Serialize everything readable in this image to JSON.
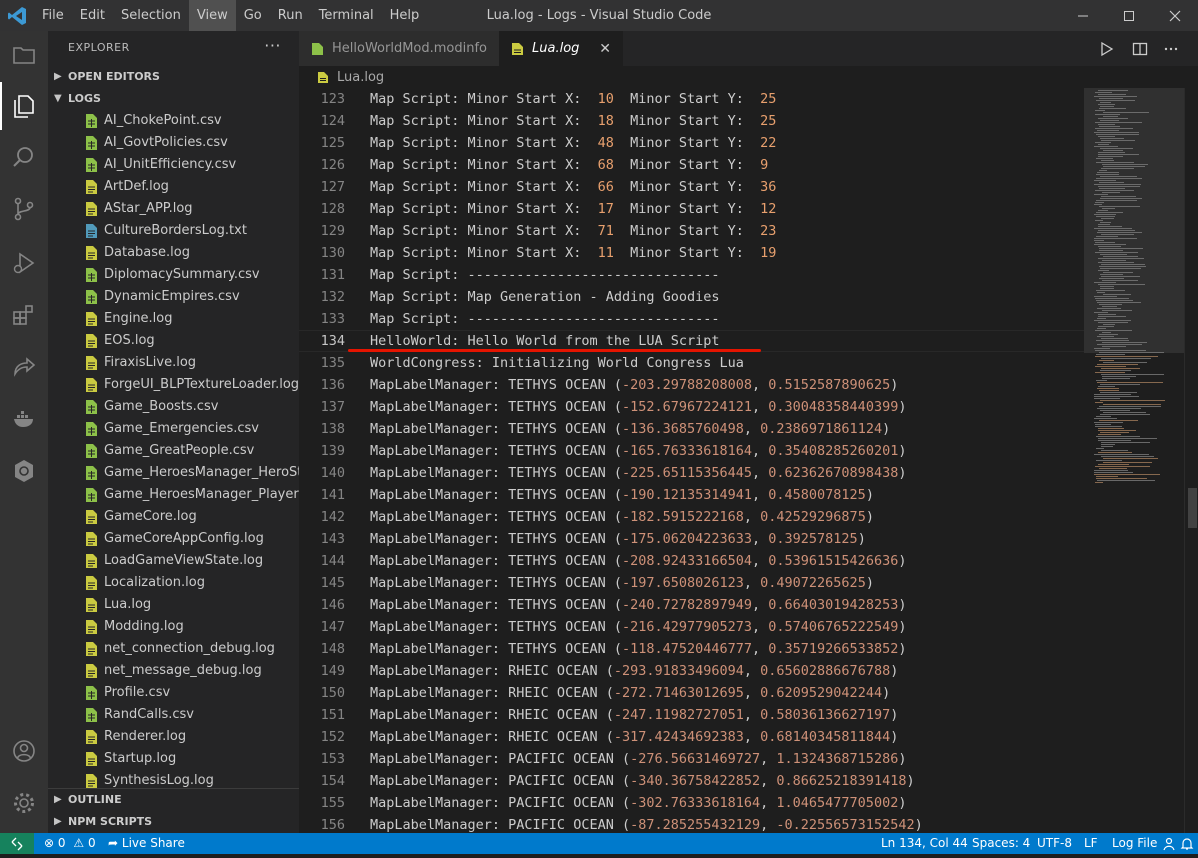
{
  "window": {
    "title": "Lua.log - Logs - Visual Studio Code"
  },
  "menu": [
    "File",
    "Edit",
    "Selection",
    "View",
    "Go",
    "Run",
    "Terminal",
    "Help"
  ],
  "explorer": {
    "title": "EXPLORER",
    "more": "···",
    "open_editors": "OPEN EDITORS",
    "folder": "LOGS",
    "files": [
      {
        "name": "AI_ChokePoint.csv",
        "type": "csv"
      },
      {
        "name": "AI_GovtPolicies.csv",
        "type": "csv"
      },
      {
        "name": "AI_UnitEfficiency.csv",
        "type": "csv"
      },
      {
        "name": "ArtDef.log",
        "type": "log"
      },
      {
        "name": "AStar_APP.log",
        "type": "log"
      },
      {
        "name": "CultureBordersLog.txt",
        "type": "txt"
      },
      {
        "name": "Database.log",
        "type": "log"
      },
      {
        "name": "DiplomacySummary.csv",
        "type": "csv"
      },
      {
        "name": "DynamicEmpires.csv",
        "type": "csv"
      },
      {
        "name": "Engine.log",
        "type": "log"
      },
      {
        "name": "EOS.log",
        "type": "log"
      },
      {
        "name": "FiraxisLive.log",
        "type": "log"
      },
      {
        "name": "ForgeUI_BLPTextureLoader.log",
        "type": "log"
      },
      {
        "name": "Game_Boosts.csv",
        "type": "csv"
      },
      {
        "name": "Game_Emergencies.csv",
        "type": "csv"
      },
      {
        "name": "Game_GreatPeople.csv",
        "type": "csv"
      },
      {
        "name": "Game_HeroesManager_HeroSta...",
        "type": "csv"
      },
      {
        "name": "Game_HeroesManager_PlayerSt...",
        "type": "csv"
      },
      {
        "name": "GameCore.log",
        "type": "log"
      },
      {
        "name": "GameCoreAppConfig.log",
        "type": "log"
      },
      {
        "name": "LoadGameViewState.log",
        "type": "log"
      },
      {
        "name": "Localization.log",
        "type": "log"
      },
      {
        "name": "Lua.log",
        "type": "log"
      },
      {
        "name": "Modding.log",
        "type": "log"
      },
      {
        "name": "net_connection_debug.log",
        "type": "log"
      },
      {
        "name": "net_message_debug.log",
        "type": "log"
      },
      {
        "name": "Profile.csv",
        "type": "csv"
      },
      {
        "name": "RandCalls.csv",
        "type": "csv"
      },
      {
        "name": "Renderer.log",
        "type": "log"
      },
      {
        "name": "Startup.log",
        "type": "log"
      },
      {
        "name": "SynthesisLog.log",
        "type": "log"
      }
    ],
    "outline": "OUTLINE",
    "npm_scripts": "NPM SCRIPTS"
  },
  "tabs": [
    {
      "label": "HelloWorldMod.modinfo",
      "active": false
    },
    {
      "label": "Lua.log",
      "active": true,
      "close": "✕"
    }
  ],
  "breadcrumb": "Lua.log",
  "editor": {
    "current_line": 134,
    "lines": [
      {
        "n": "123",
        "segs": [
          [
            "Map Script: Minor Start X:  ",
            ""
          ],
          [
            "10",
            "or"
          ],
          [
            "  Minor Start Y:  ",
            ""
          ],
          [
            "25",
            "or"
          ]
        ]
      },
      {
        "n": "124",
        "segs": [
          [
            "Map Script: Minor Start X:  ",
            ""
          ],
          [
            "18",
            "or"
          ],
          [
            "  Minor Start Y:  ",
            ""
          ],
          [
            "25",
            "or"
          ]
        ]
      },
      {
        "n": "125",
        "segs": [
          [
            "Map Script: Minor Start X:  ",
            ""
          ],
          [
            "48",
            "or"
          ],
          [
            "  Minor Start Y:  ",
            ""
          ],
          [
            "22",
            "or"
          ]
        ]
      },
      {
        "n": "126",
        "segs": [
          [
            "Map Script: Minor Start X:  ",
            ""
          ],
          [
            "68",
            "or"
          ],
          [
            "  Minor Start Y:  ",
            ""
          ],
          [
            "9",
            "or"
          ]
        ]
      },
      {
        "n": "127",
        "segs": [
          [
            "Map Script: Minor Start X:  ",
            ""
          ],
          [
            "66",
            "or"
          ],
          [
            "  Minor Start Y:  ",
            ""
          ],
          [
            "36",
            "or"
          ]
        ]
      },
      {
        "n": "128",
        "segs": [
          [
            "Map Script: Minor Start X:  ",
            ""
          ],
          [
            "17",
            "or"
          ],
          [
            "  Minor Start Y:  ",
            ""
          ],
          [
            "12",
            "or"
          ]
        ]
      },
      {
        "n": "129",
        "segs": [
          [
            "Map Script: Minor Start X:  ",
            ""
          ],
          [
            "71",
            "or"
          ],
          [
            "  Minor Start Y:  ",
            ""
          ],
          [
            "23",
            "or"
          ]
        ]
      },
      {
        "n": "130",
        "segs": [
          [
            "Map Script: Minor Start X:  ",
            ""
          ],
          [
            "11",
            "or"
          ],
          [
            "  Minor Start Y:  ",
            ""
          ],
          [
            "19",
            "or"
          ]
        ]
      },
      {
        "n": "131",
        "segs": [
          [
            "Map Script: -------------------------------",
            ""
          ]
        ]
      },
      {
        "n": "132",
        "segs": [
          [
            "Map Script: Map Generation - Adding Goodies",
            ""
          ]
        ]
      },
      {
        "n": "133",
        "segs": [
          [
            "Map Script: -------------------------------",
            ""
          ]
        ]
      },
      {
        "n": "134",
        "segs": [
          [
            "HelloWorld: Hello World from the LUA Script",
            ""
          ]
        ]
      },
      {
        "n": "135",
        "segs": [
          [
            "WorldCongress: Initializing World Congress Lua",
            ""
          ]
        ]
      },
      {
        "n": "136",
        "segs": [
          [
            "MapLabelManager: TETHYS OCEAN (",
            ""
          ],
          [
            "-203.29788208008",
            "num"
          ],
          [
            ", ",
            ""
          ],
          [
            "0.5152587890625",
            "num"
          ],
          [
            ")",
            ""
          ]
        ]
      },
      {
        "n": "137",
        "segs": [
          [
            "MapLabelManager: TETHYS OCEAN (",
            ""
          ],
          [
            "-152.67967224121",
            "num"
          ],
          [
            ", ",
            ""
          ],
          [
            "0.30048358440399",
            "num"
          ],
          [
            ")",
            ""
          ]
        ]
      },
      {
        "n": "138",
        "segs": [
          [
            "MapLabelManager: TETHYS OCEAN (",
            ""
          ],
          [
            "-136.3685760498",
            "num"
          ],
          [
            ", ",
            ""
          ],
          [
            "0.2386971861124",
            "num"
          ],
          [
            ")",
            ""
          ]
        ]
      },
      {
        "n": "139",
        "segs": [
          [
            "MapLabelManager: TETHYS OCEAN (",
            ""
          ],
          [
            "-165.76333618164",
            "num"
          ],
          [
            ", ",
            ""
          ],
          [
            "0.35408285260201",
            "num"
          ],
          [
            ")",
            ""
          ]
        ]
      },
      {
        "n": "140",
        "segs": [
          [
            "MapLabelManager: TETHYS OCEAN (",
            ""
          ],
          [
            "-225.65115356445",
            "num"
          ],
          [
            ", ",
            ""
          ],
          [
            "0.62362670898438",
            "num"
          ],
          [
            ")",
            ""
          ]
        ]
      },
      {
        "n": "141",
        "segs": [
          [
            "MapLabelManager: TETHYS OCEAN (",
            ""
          ],
          [
            "-190.12135314941",
            "num"
          ],
          [
            ", ",
            ""
          ],
          [
            "0.4580078125",
            "num"
          ],
          [
            ")",
            ""
          ]
        ]
      },
      {
        "n": "142",
        "segs": [
          [
            "MapLabelManager: TETHYS OCEAN (",
            ""
          ],
          [
            "-182.5915222168",
            "num"
          ],
          [
            ", ",
            ""
          ],
          [
            "0.42529296875",
            "num"
          ],
          [
            ")",
            ""
          ]
        ]
      },
      {
        "n": "143",
        "segs": [
          [
            "MapLabelManager: TETHYS OCEAN (",
            ""
          ],
          [
            "-175.06204223633",
            "num"
          ],
          [
            ", ",
            ""
          ],
          [
            "0.392578125",
            "num"
          ],
          [
            ")",
            ""
          ]
        ]
      },
      {
        "n": "144",
        "segs": [
          [
            "MapLabelManager: TETHYS OCEAN (",
            ""
          ],
          [
            "-208.92433166504",
            "num"
          ],
          [
            ", ",
            ""
          ],
          [
            "0.53961515426636",
            "num"
          ],
          [
            ")",
            ""
          ]
        ]
      },
      {
        "n": "145",
        "segs": [
          [
            "MapLabelManager: TETHYS OCEAN (",
            ""
          ],
          [
            "-197.6508026123",
            "num"
          ],
          [
            ", ",
            ""
          ],
          [
            "0.49072265625",
            "num"
          ],
          [
            ")",
            ""
          ]
        ]
      },
      {
        "n": "146",
        "segs": [
          [
            "MapLabelManager: TETHYS OCEAN (",
            ""
          ],
          [
            "-240.72782897949",
            "num"
          ],
          [
            ", ",
            ""
          ],
          [
            "0.66403019428253",
            "num"
          ],
          [
            ")",
            ""
          ]
        ]
      },
      {
        "n": "147",
        "segs": [
          [
            "MapLabelManager: TETHYS OCEAN (",
            ""
          ],
          [
            "-216.42977905273",
            "num"
          ],
          [
            ", ",
            ""
          ],
          [
            "0.57406765222549",
            "num"
          ],
          [
            ")",
            ""
          ]
        ]
      },
      {
        "n": "148",
        "segs": [
          [
            "MapLabelManager: TETHYS OCEAN (",
            ""
          ],
          [
            "-118.47520446777",
            "num"
          ],
          [
            ", ",
            ""
          ],
          [
            "0.35719266533852",
            "num"
          ],
          [
            ")",
            ""
          ]
        ]
      },
      {
        "n": "149",
        "segs": [
          [
            "MapLabelManager: RHEIC OCEAN (",
            ""
          ],
          [
            "-293.91833496094",
            "num"
          ],
          [
            ", ",
            ""
          ],
          [
            "0.65602886676788",
            "num"
          ],
          [
            ")",
            ""
          ]
        ]
      },
      {
        "n": "150",
        "segs": [
          [
            "MapLabelManager: RHEIC OCEAN (",
            ""
          ],
          [
            "-272.71463012695",
            "num"
          ],
          [
            ", ",
            ""
          ],
          [
            "0.6209529042244",
            "num"
          ],
          [
            ")",
            ""
          ]
        ]
      },
      {
        "n": "151",
        "segs": [
          [
            "MapLabelManager: RHEIC OCEAN (",
            ""
          ],
          [
            "-247.11982727051",
            "num"
          ],
          [
            ", ",
            ""
          ],
          [
            "0.58036136627197",
            "num"
          ],
          [
            ")",
            ""
          ]
        ]
      },
      {
        "n": "152",
        "segs": [
          [
            "MapLabelManager: RHEIC OCEAN (",
            ""
          ],
          [
            "-317.42434692383",
            "num"
          ],
          [
            ", ",
            ""
          ],
          [
            "0.68140345811844",
            "num"
          ],
          [
            ")",
            ""
          ]
        ]
      },
      {
        "n": "153",
        "segs": [
          [
            "MapLabelManager: PACIFIC OCEAN (",
            ""
          ],
          [
            "-276.56631469727",
            "num"
          ],
          [
            ", ",
            ""
          ],
          [
            "1.1324368715286",
            "num"
          ],
          [
            ")",
            ""
          ]
        ]
      },
      {
        "n": "154",
        "segs": [
          [
            "MapLabelManager: PACIFIC OCEAN (",
            ""
          ],
          [
            "-340.36758422852",
            "num"
          ],
          [
            ", ",
            ""
          ],
          [
            "0.86625218391418",
            "num"
          ],
          [
            ")",
            ""
          ]
        ]
      },
      {
        "n": "155",
        "segs": [
          [
            "MapLabelManager: PACIFIC OCEAN (",
            ""
          ],
          [
            "-302.76333618164",
            "num"
          ],
          [
            ", ",
            ""
          ],
          [
            "1.0465477705002",
            "num"
          ],
          [
            ")",
            ""
          ]
        ]
      },
      {
        "n": "156",
        "segs": [
          [
            "MapLabelManager: PACIFIC OCEAN (",
            ""
          ],
          [
            "-87.285255432129",
            "num"
          ],
          [
            ", ",
            ""
          ],
          [
            "-0.22556573152542",
            "num"
          ],
          [
            ")",
            ""
          ]
        ]
      }
    ]
  },
  "statusbar": {
    "problems": "0",
    "warnings": "0",
    "live_share": "Live Share",
    "position": "Ln 134, Col 44",
    "spaces": "Spaces: 4",
    "encoding": "UTF-8",
    "eol": "LF",
    "language": "Log File"
  },
  "colors": {
    "accent": "#007acc",
    "number": "#ce9178",
    "annotation_underline": "#e51400",
    "log_file_icon": "#cbcb41",
    "txt_file_icon": "#519aba"
  }
}
